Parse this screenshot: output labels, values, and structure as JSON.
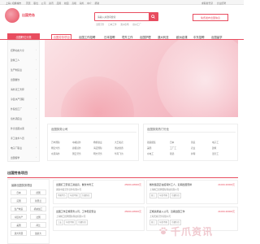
{
  "topbar": {
    "location": "上海 | 切换城市",
    "nav": [
      "首页",
      "职位",
      "公司",
      "资讯",
      "应用",
      "校园",
      "高端",
      "海外",
      "中介",
      "帮助"
    ],
    "right": [
      "求职者登录",
      "企业招聘"
    ]
  },
  "logo": {
    "text": "出国劳务"
  },
  "search": {
    "placeholder": "请输入关键词搜索",
    "hot": [
      "出国劳务",
      "日本工作",
      "澳洲农场",
      "欧洲工厂"
    ]
  },
  "hot_button": "免费发布出国信息",
  "menubar": {
    "category_head": "出国职位分类",
    "tabs": [
      "出国劳务项目",
      "出国工作招聘",
      "日本招聘",
      "境外工作",
      "出国护理",
      "澳大利亚",
      "欧洲走课",
      "中东招聘",
      "出国留学"
    ]
  },
  "sidebar": {
    "items": [
      "招聘动态大全",
      "建筑工人",
      "生产制造业",
      "出国餐饮",
      "海外流工务师",
      "冷链水产顶职",
      "外贸加工厂",
      "境外酒店业",
      "外企出国派遣",
      "手工技术人员",
      "电子厂职业",
      "出国留学"
    ]
  },
  "boxes": [
    {
      "head": "出国劳务公司",
      "cells": [
        "万丰国际",
        "中威境外",
        "杨帆旅业",
        "大王和农",
        "畅安外务",
        "捷报境外",
        "海迈国际",
        "博达旅游",
        "水源海外",
        "国云劳务",
        "明方劳务",
        "华丹飞为"
      ]
    },
    {
      "head": "出国劳务热门行业",
      "cells": [
        "船铺组装",
        "日本",
        "铸造",
        "电子工",
        "美国",
        "工厂工",
        "农业",
        "建筑",
        "水电工",
        "墓选",
        "护理",
        "温室工"
      ]
    }
  ],
  "section": {
    "title": "出国劳务项目",
    "side_head": "最新出国劳务项目",
    "tags": [
      "日本",
      "德国",
      "英国",
      "新西兰",
      "生产制造",
      "机械加工",
      "冷链水产",
      "法国",
      "美国",
      "荷兰",
      "澳大利亚",
      "加拿大"
    ]
  },
  "jobs": [
    {
      "title": "出国打工安装工资最高，餐饮市务工",
      "salary": "25000-28000元",
      "company": "湖南中装劳务合作有限公司",
      "chips": [
        "不限学历",
        "年龄不限",
        "包餐包住"
      ]
    },
    {
      "title": "餐饮集团正在招海外工人，近期出国安排",
      "salary": "21000-30000元",
      "company": "上海精工招聘国际科技有限公司",
      "chips": [
        "普工",
        "年龄不限",
        "包餐包住"
      ]
    },
    {
      "title": "出国工作正规劳务公司，工作稳定安全",
      "salary": "25000-28000元",
      "company": "上海精工招聘国际科技有限公司",
      "chips": [
        "工友",
        "年龄不限",
        "包餐包住"
      ]
    },
    {
      "title": "正规资质进入公司，近期出国工作",
      "salary": "21000-30000元",
      "company": "上海天将劳务有限公司",
      "chips": [
        "普工",
        "年龄不限",
        "包餐包住"
      ]
    }
  ],
  "watermark": "千爪资讯",
  "colors": {
    "accent": "#e84d5f",
    "banner_light": "#fbe3e6",
    "banner_dark": "#f2a9b6"
  }
}
